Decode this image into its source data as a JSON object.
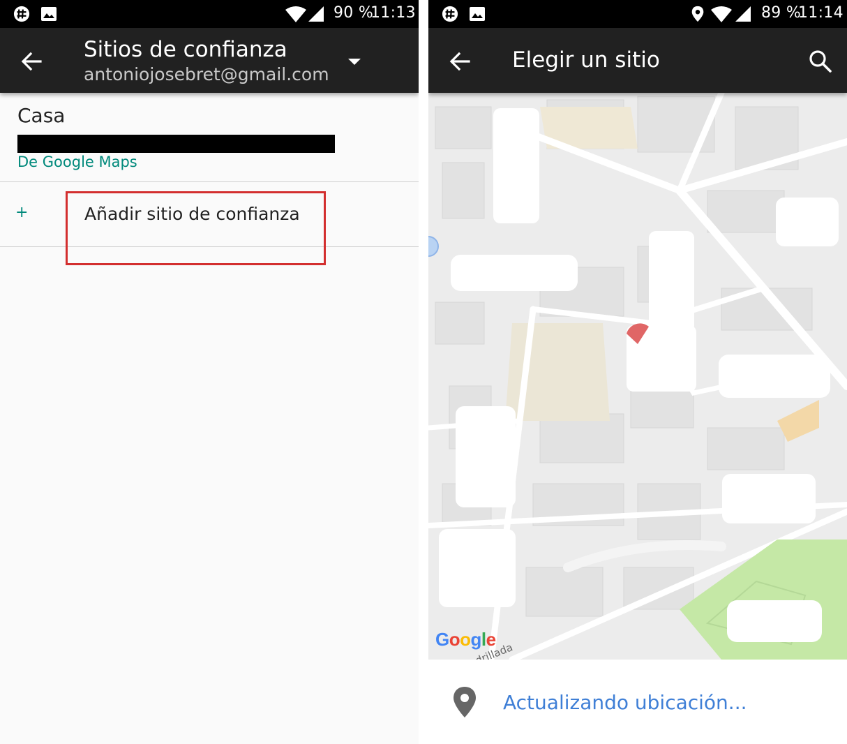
{
  "left": {
    "status_bar": {
      "battery": "90 %",
      "time": "11:13"
    },
    "header": {
      "title": "Sitios de confianza",
      "account": "antoniojosebret@gmail.com"
    },
    "places": [
      {
        "name": "Casa",
        "source": "De Google Maps"
      }
    ],
    "add_place_label": "Añadir sitio de confianza",
    "add_icon": "+"
  },
  "right": {
    "status_bar": {
      "battery": "89 %",
      "time": "11:14"
    },
    "header": {
      "title": "Elegir un sitio"
    },
    "map": {
      "brand": [
        "G",
        "o",
        "o",
        "g",
        "l",
        "e"
      ],
      "street_fragment": "drillada"
    },
    "location_status": "Actualizando ubicación..."
  },
  "colors": {
    "appbar": "#212121",
    "accent_teal": "#00897b",
    "link_blue": "#3f7fd6",
    "highlight_red": "#d32f2f",
    "park_green": "#c5e8a6"
  }
}
